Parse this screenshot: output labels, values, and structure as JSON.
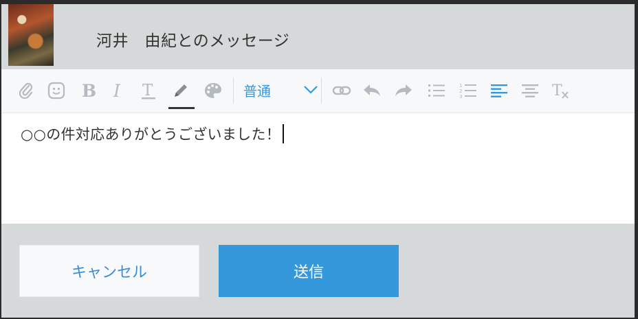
{
  "header": {
    "title": "河井　由紀とのメッセージ"
  },
  "toolbar": {
    "format_select": {
      "selected": "普通"
    },
    "accent_color": "#3498db",
    "icons": [
      "paperclip-icon",
      "emoji-icon",
      "bold-icon",
      "italic-icon",
      "text-color-icon",
      "highlight-pen-icon",
      "palette-icon",
      "link-icon",
      "undo-icon",
      "redo-icon",
      "bullet-list-icon",
      "numbered-list-icon",
      "align-left-icon",
      "align-center-icon",
      "clear-format-icon"
    ]
  },
  "editor": {
    "content": "○○の件対応ありがとうございました！"
  },
  "actions": {
    "cancel_label": "キャンセル",
    "send_label": "送信"
  }
}
